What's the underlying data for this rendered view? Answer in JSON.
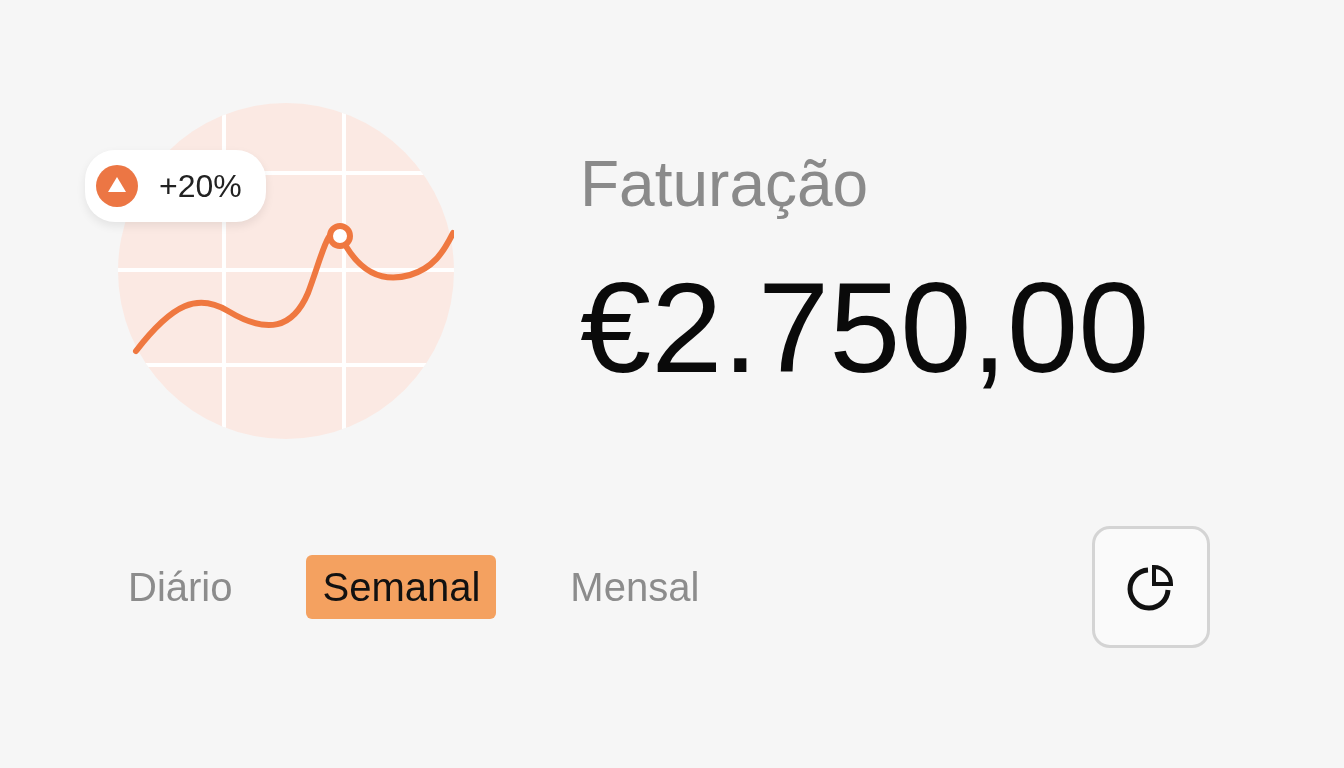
{
  "trend_badge": {
    "text": "+20%"
  },
  "title": "Faturação",
  "amount": "€2.750,00",
  "tabs": [
    {
      "label": "Diário",
      "selected": false
    },
    {
      "label": "Semanal",
      "selected": true
    },
    {
      "label": "Mensal",
      "selected": false
    }
  ],
  "chart_type_button": {
    "kind": "pie"
  }
}
